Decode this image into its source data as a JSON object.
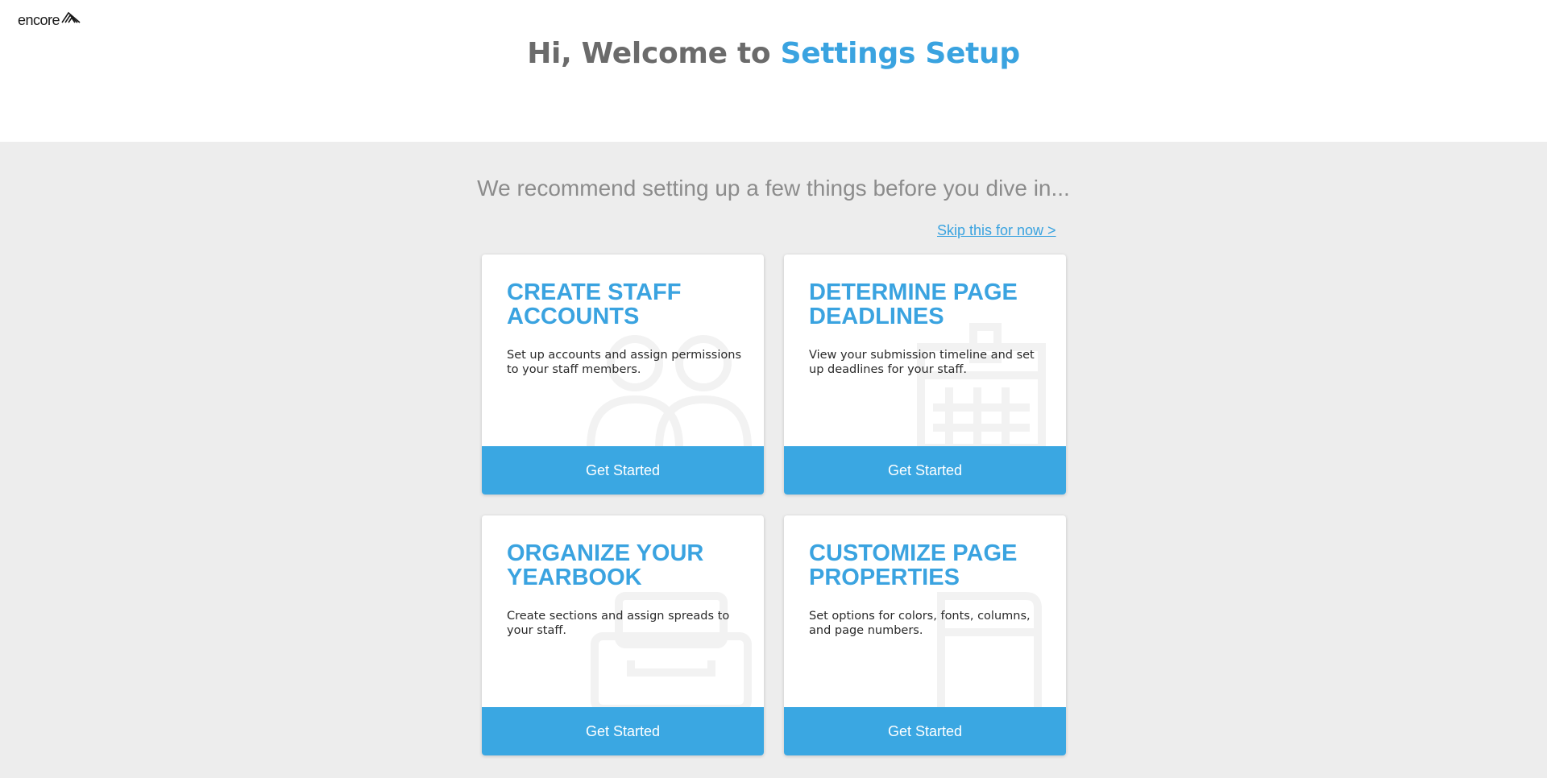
{
  "logo": {
    "text": "encore"
  },
  "header": {
    "welcome_prefix": "Hi, Welcome to",
    "welcome_accent": "Settings Setup"
  },
  "intro": {
    "recommend": "We recommend setting up a few things before you dive in...",
    "skip_label": "Skip this for now >"
  },
  "cards": [
    {
      "title": "CREATE STAFF ACCOUNTS",
      "description": "Set up accounts and assign permissions to your staff members.",
      "button": "Get Started",
      "icon": "people-icon"
    },
    {
      "title": "DETERMINE PAGE DEADLINES",
      "description": "View your submission timeline and set up deadlines for your staff.",
      "button": "Get Started",
      "icon": "calendar-icon"
    },
    {
      "title": "ORGANIZE YOUR YEARBOOK",
      "description": "Create sections and assign spreads to your staff.",
      "button": "Get Started",
      "icon": "file-box-icon"
    },
    {
      "title": "CUSTOMIZE PAGE PROPERTIES",
      "description": "Set options for colors, fonts, columns, and page numbers.",
      "button": "Get Started",
      "icon": "page-icon"
    }
  ],
  "colors": {
    "accent": "#3aa3e0",
    "button": "#3aa7e2",
    "background": "#ededed"
  }
}
